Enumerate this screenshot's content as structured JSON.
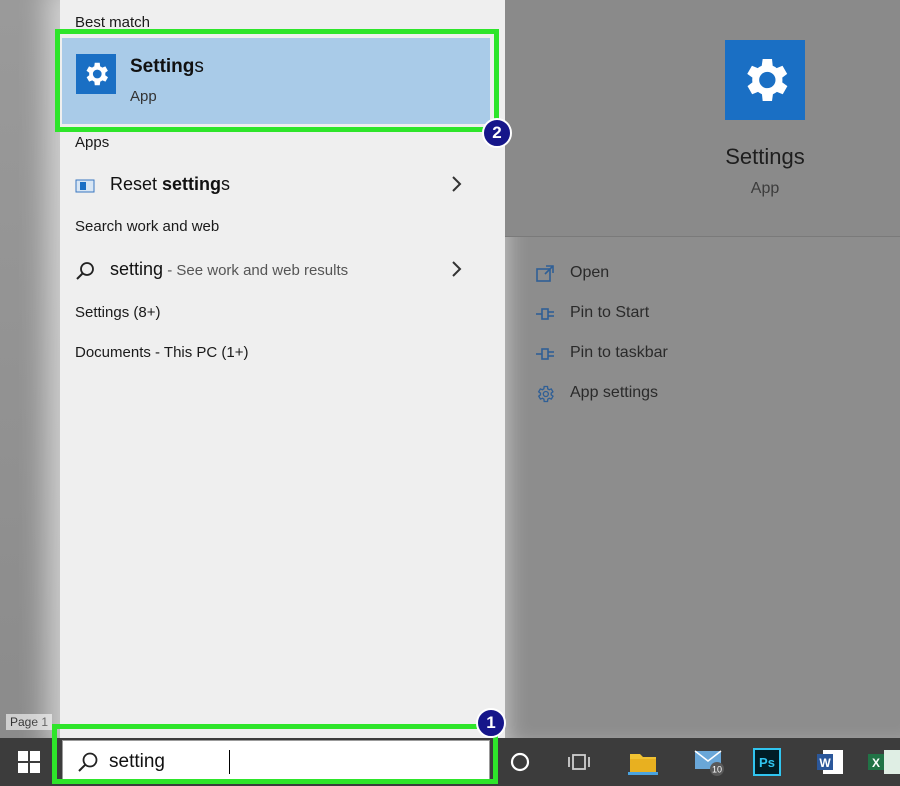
{
  "background": {
    "page_label": "Page 1"
  },
  "results": {
    "best_match_heading": "Best match",
    "best_match": {
      "title_bold": "Setting",
      "title_rest": "s",
      "subtitle": "App"
    },
    "apps_heading": "Apps",
    "apps": [
      {
        "prefix": "Reset ",
        "bold": "setting",
        "suffix": "s"
      }
    ],
    "web_heading": "Search work and web",
    "web": [
      {
        "query": "setting",
        "hint": " - See work and web results"
      }
    ],
    "settings_heading": "Settings (8+)",
    "documents_heading": "Documents - This PC (1+)"
  },
  "preview": {
    "title": "Settings",
    "subtitle": "App",
    "actions": [
      {
        "label": "Open",
        "icon": "open-icon"
      },
      {
        "label": "Pin to Start",
        "icon": "pin-icon"
      },
      {
        "label": "Pin to taskbar",
        "icon": "pin-icon"
      },
      {
        "label": "App settings",
        "icon": "gear-icon"
      }
    ]
  },
  "taskbar": {
    "search_value": "setting",
    "mail_badge": "10",
    "ps_label": "Ps",
    "word_label": "W",
    "excel_label": "X"
  },
  "annotations": {
    "step1": "1",
    "step2": "2"
  },
  "colors": {
    "accent": "#1a6fc4",
    "highlight": "#2ee52a",
    "selection": "#a9cbe8",
    "badge": "#16168a"
  }
}
